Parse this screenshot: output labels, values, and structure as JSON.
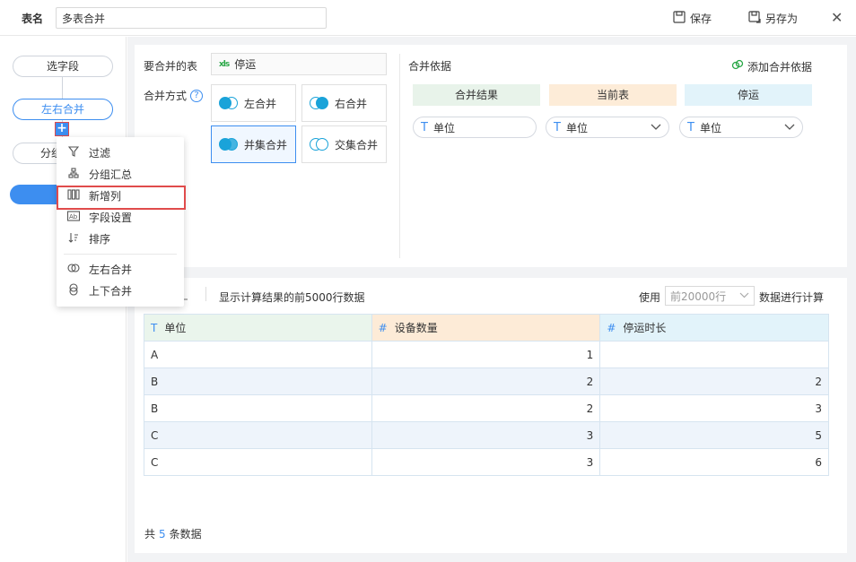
{
  "header": {
    "table_name_label": "表名",
    "table_name_value": "多表合并",
    "save_label": "保存",
    "save_as_label": "另存为",
    "close_symbol": "✕"
  },
  "flow": {
    "select_field": "选字段",
    "lr_merge": "左右合并",
    "group": "分组",
    "add_symbol": "+"
  },
  "menu": {
    "filter": "过滤",
    "group_summary": "分组汇总",
    "add_column": "新增列",
    "field_settings": "字段设置",
    "sort": "排序",
    "lr_merge": "左右合并",
    "ud_merge": "上下合并"
  },
  "config": {
    "tables_label": "要合并的表",
    "merge_table_icon": "xls",
    "merge_table_name": "停运",
    "merge_method_label": "合并方式",
    "help_symbol": "?",
    "methods": {
      "left": "左合并",
      "right": "右合并",
      "union": "并集合并",
      "intersect": "交集合并"
    },
    "selected_method": "union",
    "basis_label": "合并依据",
    "add_basis": "添加合并依据",
    "basis_headers": {
      "result": "合并结果",
      "current": "当前表",
      "tingyun": "停运"
    },
    "basis_fields": {
      "result": "单位",
      "current": "单位",
      "tingyun": "单位"
    }
  },
  "preview": {
    "desc": "显示计算结果的前5000行数据",
    "use_label": "使用",
    "row_limit_placeholder": "前20000行",
    "calc_label": "数据进行计算",
    "columns": [
      {
        "type_icon": "T",
        "name": "单位"
      },
      {
        "type_icon": "#",
        "name": "设备数量"
      },
      {
        "type_icon": "#",
        "name": "停运时长"
      }
    ],
    "rows": [
      [
        "A",
        "1",
        ""
      ],
      [
        "B",
        "2",
        "2"
      ],
      [
        "B",
        "2",
        "3"
      ],
      [
        "C",
        "3",
        "5"
      ],
      [
        "C",
        "3",
        "6"
      ]
    ],
    "total_prefix": "共",
    "total_count": "5",
    "total_suffix": "条数据"
  },
  "colors": {
    "accent": "#3d8ef0",
    "highlight": "#e04b4b",
    "result_bg": "#eaf5ec",
    "current_bg": "#fdebd7",
    "tingyun_bg": "#e2f3fa"
  }
}
